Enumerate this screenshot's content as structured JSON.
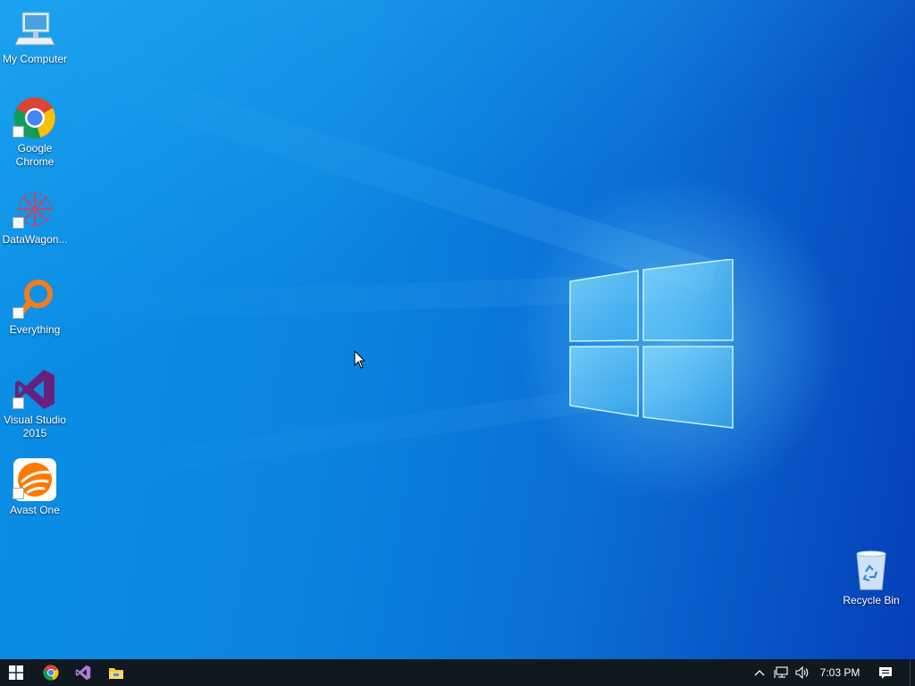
{
  "desktop": {
    "icons": [
      {
        "label": "My Computer",
        "icon": "computer-icon",
        "shortcut": false
      },
      {
        "label": "Google Chrome",
        "icon": "chrome-icon",
        "shortcut": true
      },
      {
        "label": "DataWagon...",
        "icon": "datawagon-icon",
        "shortcut": true
      },
      {
        "label": "Everything",
        "icon": "everything-icon",
        "shortcut": true
      },
      {
        "label": "Visual Studio 2015",
        "icon": "visual-studio-icon",
        "shortcut": true
      },
      {
        "label": "Avast One",
        "icon": "avast-icon",
        "shortcut": true
      }
    ],
    "recycle_bin": {
      "label": "Recycle Bin",
      "icon": "recycle-bin-icon"
    }
  },
  "taskbar": {
    "start_icon": "windows-start-icon",
    "pinned": [
      {
        "name": "Google Chrome",
        "icon": "chrome-icon"
      },
      {
        "name": "Visual Studio",
        "icon": "visual-studio-icon"
      },
      {
        "name": "File Explorer",
        "icon": "folder-icon"
      }
    ],
    "tray": {
      "chevron_icon": "chevron-up-icon",
      "network_icon": "network-icon",
      "volume_icon": "volume-icon",
      "time": "7:03 PM",
      "notification_icon": "action-center-icon"
    }
  },
  "colors": {
    "desktop_blue": "#0a86e0",
    "taskbar": "#101820",
    "accent": "#67c7f5"
  }
}
